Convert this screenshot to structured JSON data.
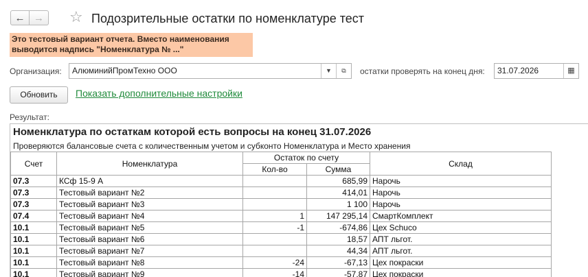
{
  "nav": {
    "back_icon": "←",
    "forward_icon": "→",
    "star_icon": "☆"
  },
  "window": {
    "title": "Подозрительные остатки по номенклатуре тест"
  },
  "warning": {
    "line1": "Это тестовый вариант отчета. Вместо наименования",
    "line2": "выводится надпись \"Номенклатура № ...\""
  },
  "form": {
    "org_label": "Организация:",
    "org_value": "АлюминийПромТехно ООО",
    "date_label": "остатки проверять на конец дня:",
    "date_value": "31.07.2026",
    "refresh_label": "Обновить",
    "settings_link": "Показать дополнительные настройки",
    "result_label": "Результат:"
  },
  "report": {
    "title": "Номенклатура по остаткам которой есть вопросы на конец 31.07.2026",
    "subtitle": "Проверяются балансовые счета с количественным учетом и субконто Номенклатура и Место хранения",
    "headers": {
      "account": "Счет",
      "item": "Номенклатура",
      "balance": "Остаток по счету",
      "qty": "Кол-во",
      "sum": "Сумма",
      "warehouse": "Склад"
    },
    "rows": [
      {
        "account": "07.3",
        "item": "КСф 15-9 А",
        "qty": "",
        "sum": "685,99",
        "warehouse": "Нарочь"
      },
      {
        "account": "07.3",
        "item": "Тестовый вариант №2",
        "qty": "",
        "sum": "414,01",
        "warehouse": "Нарочь"
      },
      {
        "account": "07.3",
        "item": "Тестовый вариант №3",
        "qty": "",
        "sum": "1 100",
        "warehouse": "Нарочь"
      },
      {
        "account": "07.4",
        "item": "Тестовый вариант №4",
        "qty": "1",
        "sum": "147 295,14",
        "warehouse": "СмартКомплект"
      },
      {
        "account": "10.1",
        "item": "Тестовый вариант №5",
        "qty": "-1",
        "sum": "-674,86",
        "warehouse": "Цех Schuco"
      },
      {
        "account": "10.1",
        "item": "Тестовый вариант №6",
        "qty": "",
        "sum": "18,57",
        "warehouse": "АПТ льгот."
      },
      {
        "account": "10.1",
        "item": "Тестовый вариант №7",
        "qty": "",
        "sum": "44,34",
        "warehouse": "АПТ льгот."
      },
      {
        "account": "10.1",
        "item": "Тестовый вариант №8",
        "qty": "-24",
        "sum": "-67,13",
        "warehouse": "Цех покраски"
      },
      {
        "account": "10.1",
        "item": "Тестовый вариант №9",
        "qty": "-14",
        "sum": "-57,87",
        "warehouse": "Цех покраски"
      }
    ]
  }
}
